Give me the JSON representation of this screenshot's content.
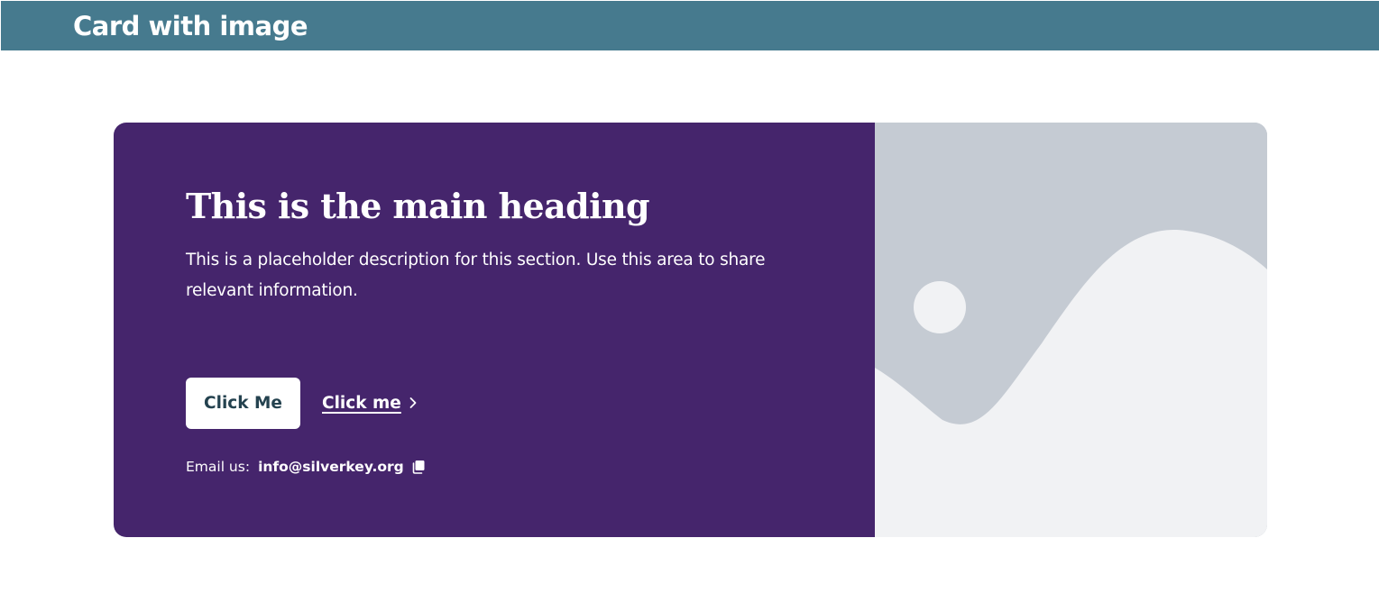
{
  "header": {
    "title": "Card with image"
  },
  "card": {
    "heading": "This is the main heading",
    "description": "This is a placeholder description for this section. Use this area to share relevant information.",
    "primary_button_label": "Click Me",
    "link_button_label": "Click me",
    "email_label": "Email us:",
    "email_address": "info@silverkey.org"
  },
  "icons": {
    "link_arrow": "chevron-right-icon",
    "copy": "copy-icon",
    "image": "image-placeholder-icon"
  },
  "colors": {
    "header_bg": "#467a8e",
    "card_bg": "#45256c",
    "image_bg": "#c5cbd3",
    "image_fg": "#f1f2f4",
    "primary_button_text": "#24424f"
  }
}
